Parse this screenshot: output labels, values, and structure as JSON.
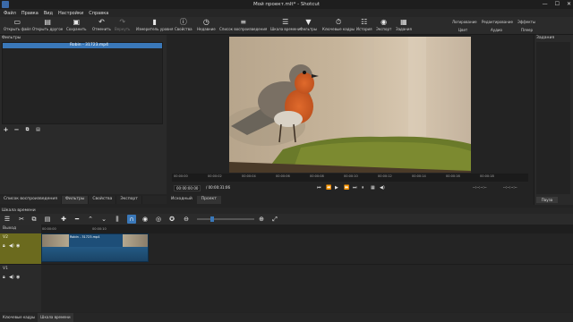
{
  "window": {
    "title": "Мой проект.mlt* - Shotcut",
    "controls": [
      "—",
      "☐",
      "✕"
    ]
  },
  "menu": [
    "Файл",
    "Правка",
    "Вид",
    "Настройки",
    "Справка"
  ],
  "toolbar": {
    "buttons": [
      {
        "label": "Открыть файл",
        "icon": "folder-open-icon"
      },
      {
        "label": "Открыть другое",
        "icon": "open-other-icon"
      },
      {
        "label": "Сохранить",
        "icon": "save-icon"
      },
      {
        "label": "Отменить",
        "icon": "undo-icon"
      },
      {
        "label": "Вернуть",
        "icon": "redo-icon"
      },
      {
        "label": "Измеритель уровня",
        "icon": "audio-meter-icon"
      },
      {
        "label": "Свойства",
        "icon": "properties-icon"
      },
      {
        "label": "Недавние",
        "icon": "recent-icon"
      },
      {
        "label": "Список воспроизведения",
        "icon": "playlist-icon"
      },
      {
        "label": "Шкала времени",
        "icon": "timeline-icon"
      },
      {
        "label": "Фильтры",
        "icon": "filter-icon"
      },
      {
        "label": "Ключевые кадры",
        "icon": "keyframes-icon"
      },
      {
        "label": "История",
        "icon": "history-icon"
      },
      {
        "label": "Экспорт",
        "icon": "export-icon"
      },
      {
        "label": "Задания",
        "icon": "jobs-icon"
      }
    ],
    "layouts_top": [
      "Логирование",
      "Редактирование",
      "Эффекты"
    ],
    "layouts_bottom": [
      "Цвет",
      "Аудио",
      "Плеер"
    ]
  },
  "filters": {
    "header": "Фильтры",
    "current_clip": "Robin - 31723.mp4"
  },
  "jobs": {
    "header": "Задания",
    "pause_label": "Пауза"
  },
  "viewer": {
    "ruler_labels": [
      "00:00:00",
      "00:00:02",
      "00:00:04",
      "00:00:06",
      "00:00:08",
      "00:00:10",
      "00:00:12",
      "00:00:14",
      "00:00:16",
      "00:00:18"
    ],
    "current_time": "00:00:00:00",
    "total_time": "/ 00:00:31:06",
    "in_point": "--:--:--:--",
    "out_point": "--:--:--:--",
    "source_tab": "Исходный",
    "project_tab": "Проект"
  },
  "left_tabs": [
    "Список воспроизведения",
    "Фильтры",
    "Свойства",
    "Экспорт"
  ],
  "timeline": {
    "header": "Шкала времени",
    "ruler": [
      "00:00:00",
      "00:00:10"
    ],
    "tracks": [
      {
        "name": "Выход"
      },
      {
        "name": "V2",
        "clip": "Robin - 31723.mp4"
      },
      {
        "name": "V1"
      }
    ]
  },
  "bottom_tabs": [
    "Ключевые кадры",
    "Шкала времени"
  ]
}
